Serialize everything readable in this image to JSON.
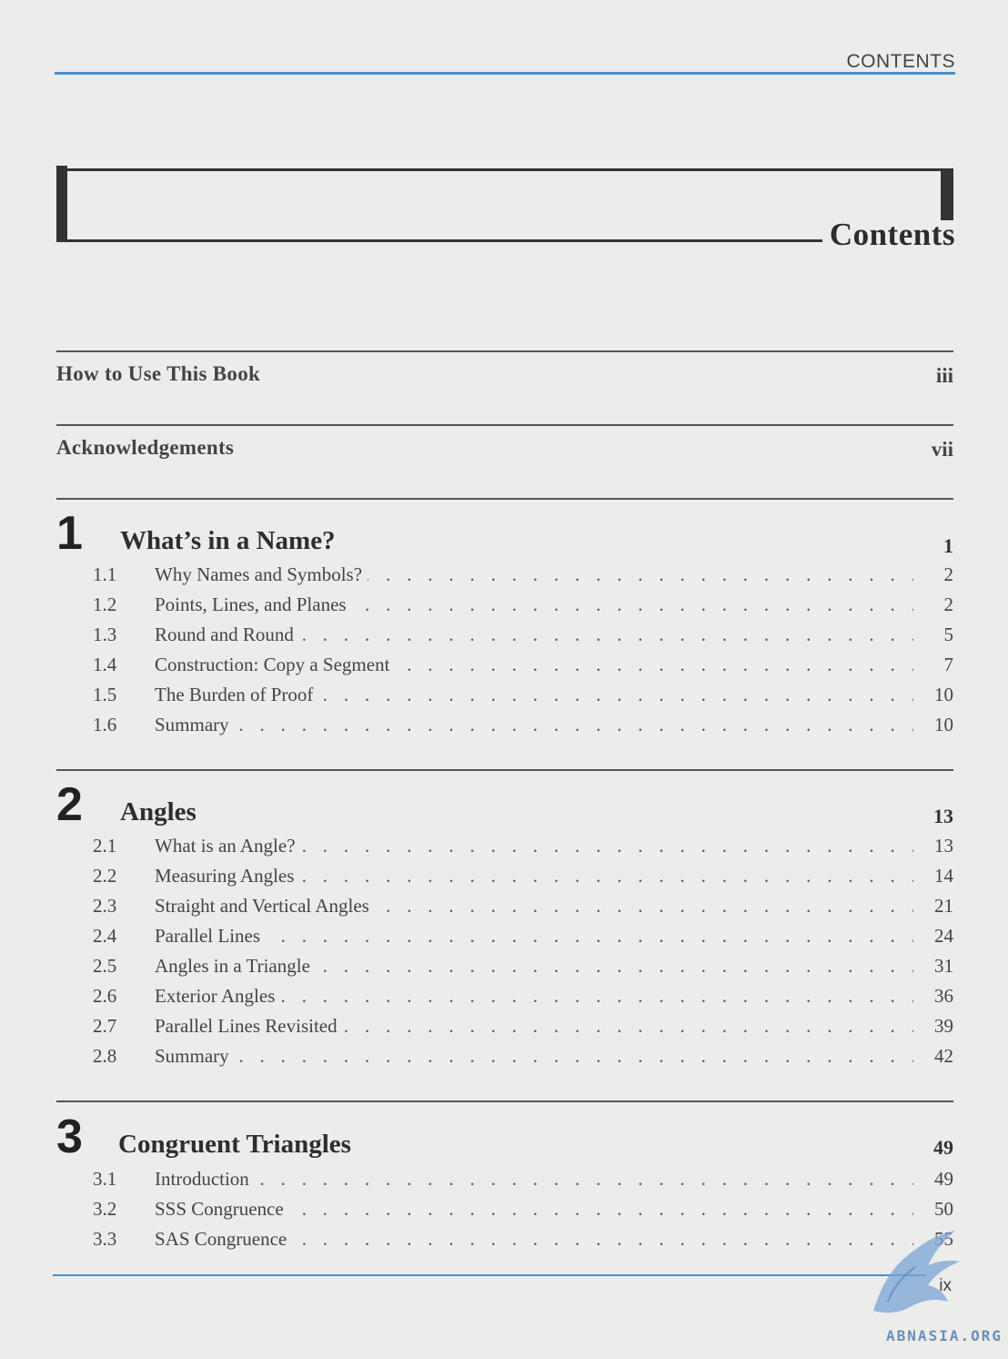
{
  "running_head": "CONTENTS",
  "page_title": "Contents",
  "front_matter": [
    {
      "label": "How to Use This Book",
      "page": "iii"
    },
    {
      "label": "Acknowledgements",
      "page": "vii"
    }
  ],
  "chapters": [
    {
      "number": "1",
      "title": "What’s in a Name?",
      "page": "1",
      "sections": [
        {
          "num": "1.1",
          "title": "Why Names and Symbols?",
          "page": "2"
        },
        {
          "num": "1.2",
          "title": "Points, Lines, and Planes",
          "page": "2"
        },
        {
          "num": "1.3",
          "title": "Round and Round",
          "page": "5"
        },
        {
          "num": "1.4",
          "title": "Construction: Copy a Segment",
          "page": "7"
        },
        {
          "num": "1.5",
          "title": "The Burden of Proof",
          "page": "10"
        },
        {
          "num": "1.6",
          "title": "Summary",
          "page": "10"
        }
      ]
    },
    {
      "number": "2",
      "title": "Angles",
      "page": "13",
      "sections": [
        {
          "num": "2.1",
          "title": "What is an Angle?",
          "page": "13"
        },
        {
          "num": "2.2",
          "title": "Measuring Angles",
          "page": "14"
        },
        {
          "num": "2.3",
          "title": "Straight and Vertical Angles",
          "page": "21"
        },
        {
          "num": "2.4",
          "title": "Parallel Lines",
          "page": "24"
        },
        {
          "num": "2.5",
          "title": "Angles in a Triangle",
          "page": "31"
        },
        {
          "num": "2.6",
          "title": "Exterior Angles",
          "page": "36"
        },
        {
          "num": "2.7",
          "title": "Parallel Lines Revisited",
          "page": "39"
        },
        {
          "num": "2.8",
          "title": "Summary",
          "page": "42"
        }
      ]
    },
    {
      "number": "3",
      "title": "Congruent Triangles",
      "page": "49",
      "sections": [
        {
          "num": "3.1",
          "title": "Introduction",
          "page": "49"
        },
        {
          "num": "3.2",
          "title": "SSS Congruence",
          "page": "50"
        },
        {
          "num": "3.3",
          "title": "SAS Congruence",
          "page": "55"
        }
      ]
    }
  ],
  "folio": "ix",
  "watermark": "ABNASIA.ORG",
  "colors": {
    "accent_rule": "#4a8fd0",
    "watermark": "#6a8fb8"
  }
}
